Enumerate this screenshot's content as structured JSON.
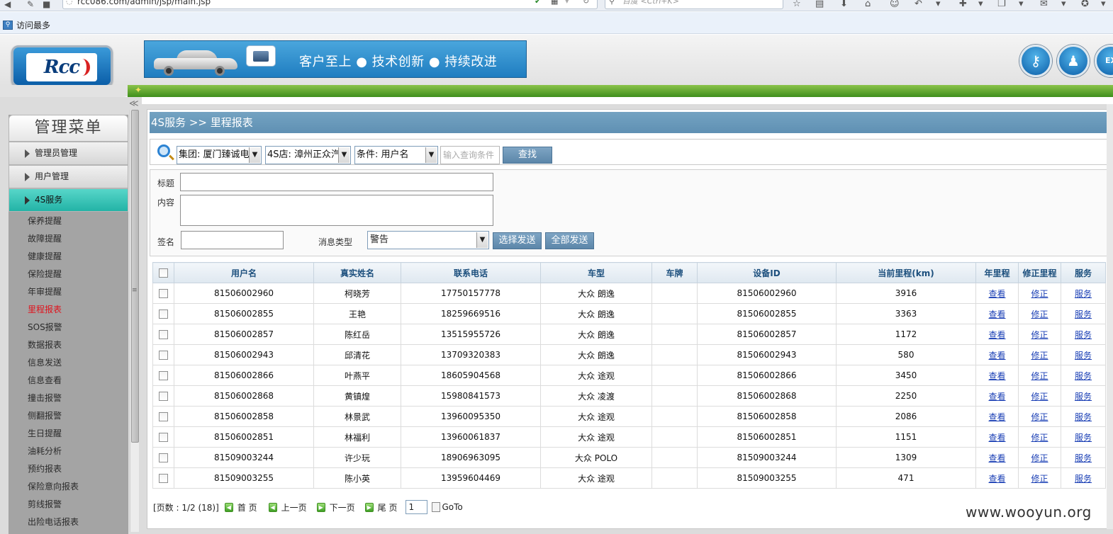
{
  "browser": {
    "url": "rcc086.com/admin/jsp/main.jsp",
    "search_placeholder": "百度 <Ctrl+K>",
    "bookmark": "访问最多"
  },
  "header": {
    "logo_text": "Rcc",
    "slogan": "客户至上 ● 技术创新 ● 持续改进",
    "exit_label": "EX"
  },
  "sidebar": {
    "title": "管理菜单",
    "sections": [
      "管理员管理",
      "用户管理",
      "4S服务"
    ],
    "items": [
      "保养提醒",
      "故障提醒",
      "健康提醒",
      "保险提醒",
      "年审提醒",
      "里程报表",
      "SOS报警",
      "数据报表",
      "信息发送",
      "信息查看",
      "撞击报警",
      "侧翻报警",
      "生日提醒",
      "油耗分析",
      "预约报表",
      "保险意向报表",
      "剪线报警",
      "出险电话报表"
    ],
    "current": "里程报表"
  },
  "breadcrumb": "4S服务 >> 里程报表",
  "search": {
    "group": "集团: 厦门臻诚电",
    "store": "4S店: 漳州正众汽",
    "condition": "条件: 用户名",
    "placeholder": "输入查询条件",
    "button": "查找"
  },
  "message": {
    "title_label": "标题",
    "content_label": "内容",
    "sign_label": "签名",
    "type_label": "消息类型",
    "type_value": "警告",
    "send_selected": "选择发送",
    "send_all": "全部发送"
  },
  "table": {
    "headers": [
      "用户名",
      "真实姓名",
      "联系电话",
      "车型",
      "车牌",
      "设备ID",
      "当前里程(km)",
      "年里程",
      "修正里程",
      "服务"
    ],
    "rows": [
      [
        "81506002960",
        "柯晓芳",
        "17750157778",
        "大众 朗逸",
        "",
        "81506002960",
        "3916"
      ],
      [
        "81506002855",
        "王艳",
        "18259669516",
        "大众 朗逸",
        "",
        "81506002855",
        "3363"
      ],
      [
        "81506002857",
        "陈红岳",
        "13515955726",
        "大众 朗逸",
        "",
        "81506002857",
        "1172"
      ],
      [
        "81506002943",
        "邱清花",
        "13709320383",
        "大众 朗逸",
        "",
        "81506002943",
        "580"
      ],
      [
        "81506002866",
        "叶燕平",
        "18605904568",
        "大众 途观",
        "",
        "81506002866",
        "3450"
      ],
      [
        "81506002868",
        "黄镇煌",
        "15980841573",
        "大众 凌渡",
        "",
        "81506002868",
        "2250"
      ],
      [
        "81506002858",
        "林景武",
        "13960095350",
        "大众 途观",
        "",
        "81506002858",
        "2086"
      ],
      [
        "81506002851",
        "林福利",
        "13960061837",
        "大众 途观",
        "",
        "81506002851",
        "1151"
      ],
      [
        "81509003244",
        "许少玩",
        "18906963095",
        "大众 POLO",
        "",
        "81509003244",
        "1309"
      ],
      [
        "81509003255",
        "陈小英",
        "13959604469",
        "大众 途观",
        "",
        "81509003255",
        "471"
      ]
    ],
    "link_view": "查看",
    "link_fix": "修正",
    "link_service": "服务"
  },
  "pager": {
    "info": "[页数 : 1/2 (18)]",
    "first": "首 页",
    "prev": "上一页",
    "next": "下一页",
    "last": "尾 页",
    "page_value": "1",
    "goto": "GoTo"
  },
  "watermark": "www.wooyun.org"
}
